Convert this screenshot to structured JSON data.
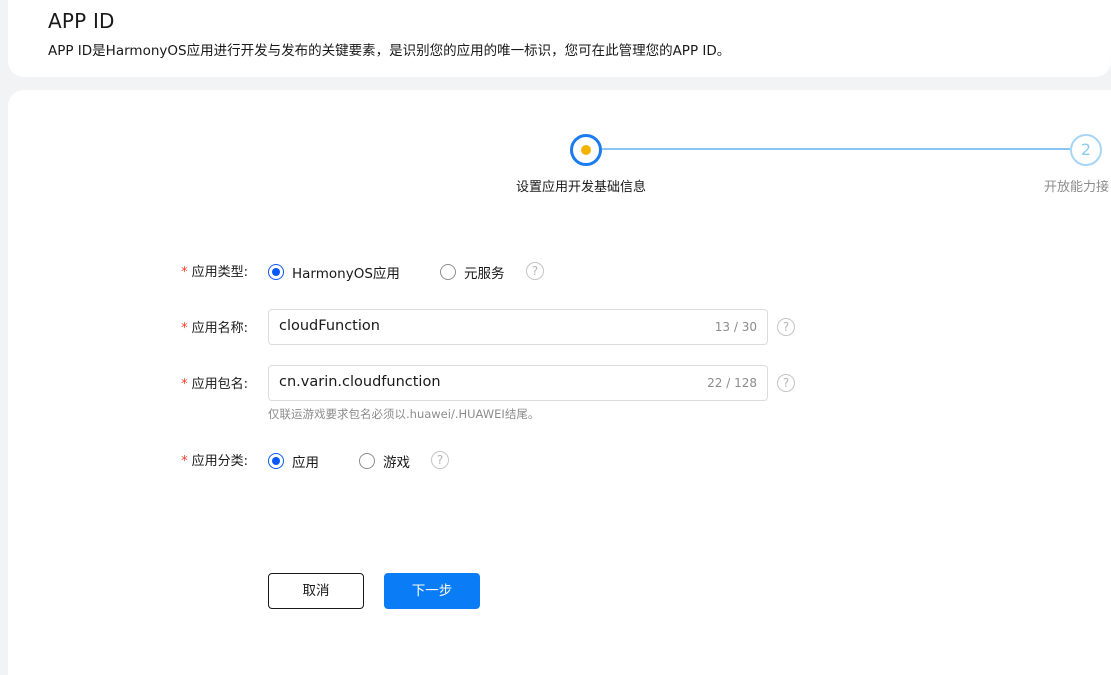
{
  "header": {
    "title": "APP ID",
    "description": "APP ID是HarmonyOS应用进行开发与发布的关键要素，是识别您的应用的唯一标识，您可在此管理您的APP ID。"
  },
  "stepper": {
    "steps": [
      {
        "label": "设置应用开发基础信息",
        "state": "active"
      },
      {
        "number": "2",
        "label": "开放能力接",
        "state": "pending"
      }
    ]
  },
  "form": {
    "required_mark": "*",
    "app_type": {
      "label": "应用类型:",
      "options": [
        "HarmonyOS应用",
        "元服务"
      ],
      "selected": "HarmonyOS应用"
    },
    "app_name": {
      "label": "应用名称:",
      "value": "cloudFunction",
      "counter": "13 / 30"
    },
    "package_name": {
      "label": "应用包名:",
      "value": "cn.varin.cloudfunction",
      "counter": "22 / 128",
      "hint": "仅联运游戏要求包名必须以.huawei/.HUAWEI结尾。"
    },
    "category": {
      "label": "应用分类:",
      "options": [
        "应用",
        "游戏"
      ],
      "selected": "应用"
    },
    "help_glyph": "?"
  },
  "buttons": {
    "cancel": "取消",
    "next": "下一步"
  },
  "colors": {
    "primary": "#0a7cf5",
    "step_active_dot": "#f5b301",
    "step_line": "#85c7f2",
    "required": "#e84026"
  }
}
